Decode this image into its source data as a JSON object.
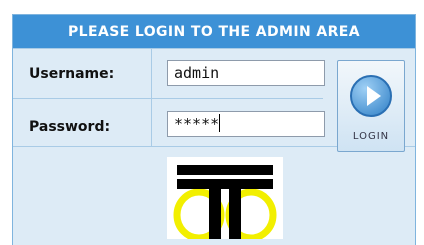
{
  "header": {
    "title": "PLEASE LOGIN TO THE ADMIN AREA"
  },
  "form": {
    "username_label": "Username:",
    "username_value": "admin",
    "password_label": "Password:",
    "password_value": "*****"
  },
  "login_button": {
    "label": "LOGIN"
  },
  "logo": {
    "icon": "t-logo-icon",
    "colors": {
      "bars": "#000000",
      "rings": "#f2ef00"
    }
  }
}
